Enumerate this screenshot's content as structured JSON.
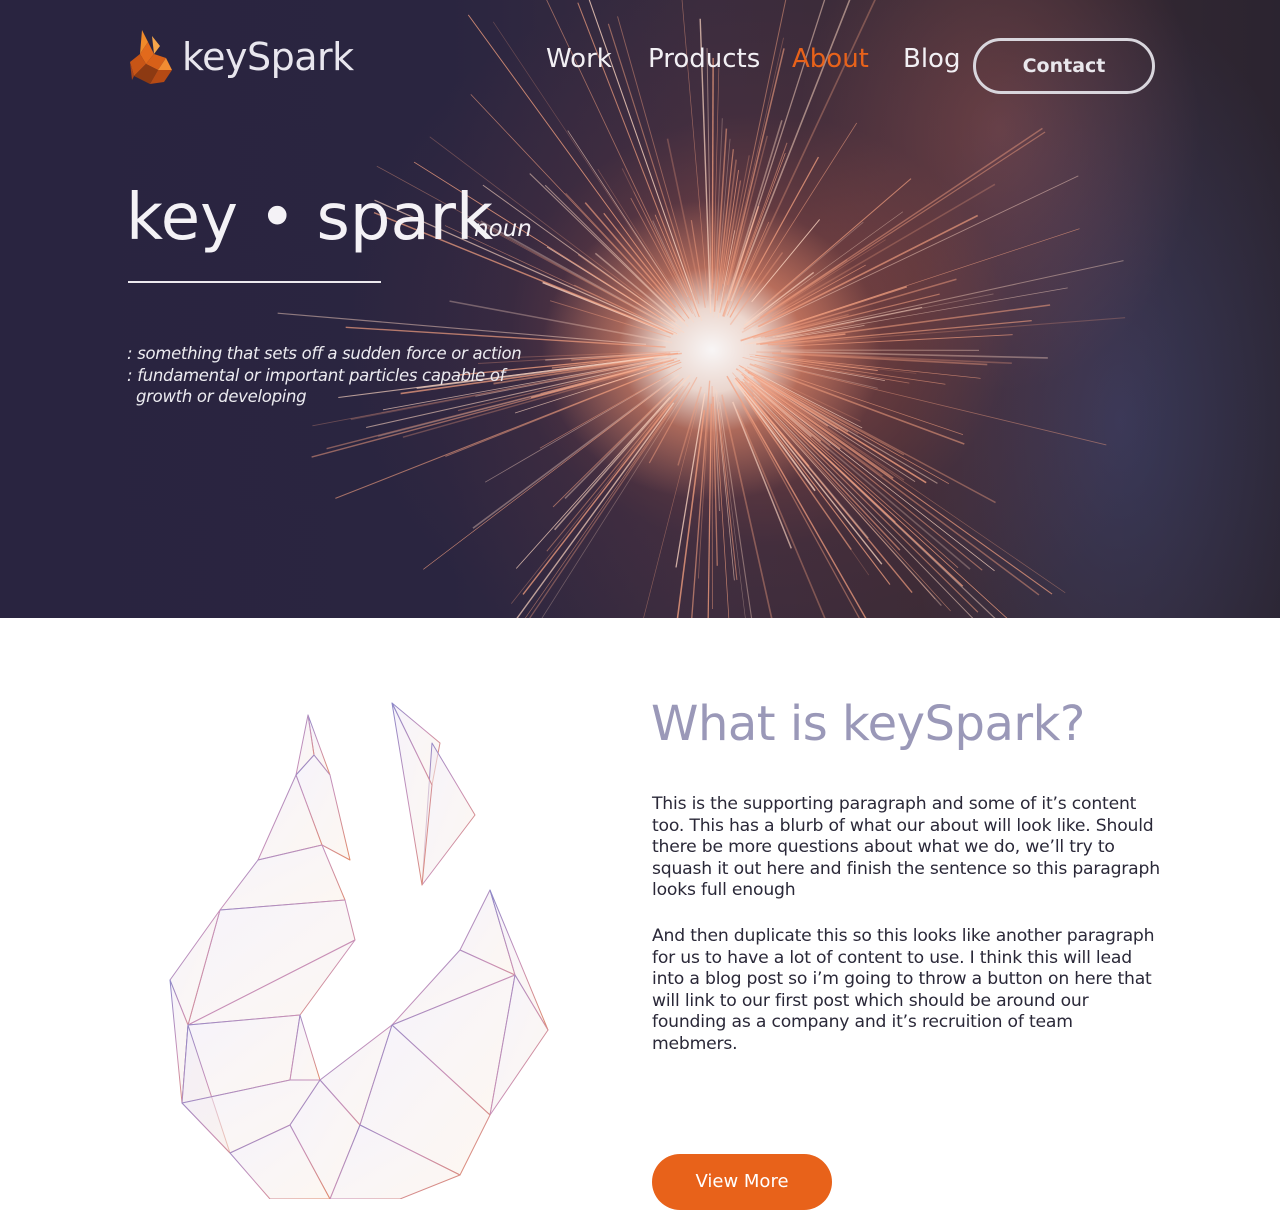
{
  "brand": {
    "logo_text": "keySpark",
    "accent_color": "#e8621a"
  },
  "nav": {
    "items": [
      {
        "label": "Work",
        "active": false
      },
      {
        "label": "Products",
        "active": false
      },
      {
        "label": "About",
        "active": true
      },
      {
        "label": "Blog",
        "active": false
      }
    ],
    "contact_label": "Contact"
  },
  "hero": {
    "word": "key • spark",
    "part_of_speech": "noun",
    "definitions": [
      ": something that sets off a sudden force or action",
      ": fundamental or important particles capable of",
      "growth or developing"
    ]
  },
  "about": {
    "title": "What is keySpark?",
    "paragraphs": [
      "This is the supporting paragraph and some of it’s content too. This has a blurb of what our about will look like. Should there be more questions about what we do, we’ll try to squash it out here and finish the sentence so this paragraph looks full enough",
      "And then duplicate this so this looks like another paragraph for us to have a lot of content to use. I think this will lead into a blog post so i’m going to throw a button on here that will link to our first post which should be around our founding as a company and it’s recruition of team mebmers."
    ],
    "button_label": "View More"
  }
}
